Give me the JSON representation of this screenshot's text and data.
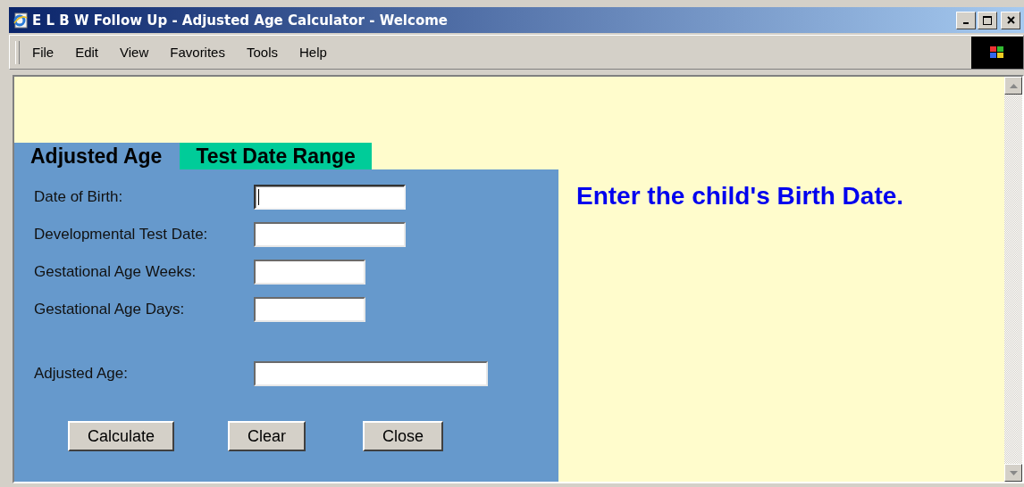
{
  "window": {
    "title": "E L B W Follow Up - Adjusted Age Calculator - Welcome"
  },
  "menu": [
    "File",
    "Edit",
    "View",
    "Favorites",
    "Tools",
    "Help"
  ],
  "tabs": [
    {
      "label": "Adjusted Age",
      "selected": true
    },
    {
      "label": "Test Date Range",
      "selected": false
    }
  ],
  "fields": [
    {
      "label": "Date of Birth:",
      "kind": "date",
      "focused": true
    },
    {
      "label": "Developmental Test Date:",
      "kind": "date",
      "focused": false
    },
    {
      "label": "Gestational Age Weeks:",
      "kind": "number",
      "focused": false
    },
    {
      "label": "Gestational Age Days:",
      "kind": "number",
      "focused": false
    },
    {
      "label": "Adjusted Age:",
      "kind": "result",
      "focused": false
    }
  ],
  "buttons": [
    "Calculate",
    "Clear",
    "Close"
  ],
  "message": "Enter the child's Birth Date."
}
